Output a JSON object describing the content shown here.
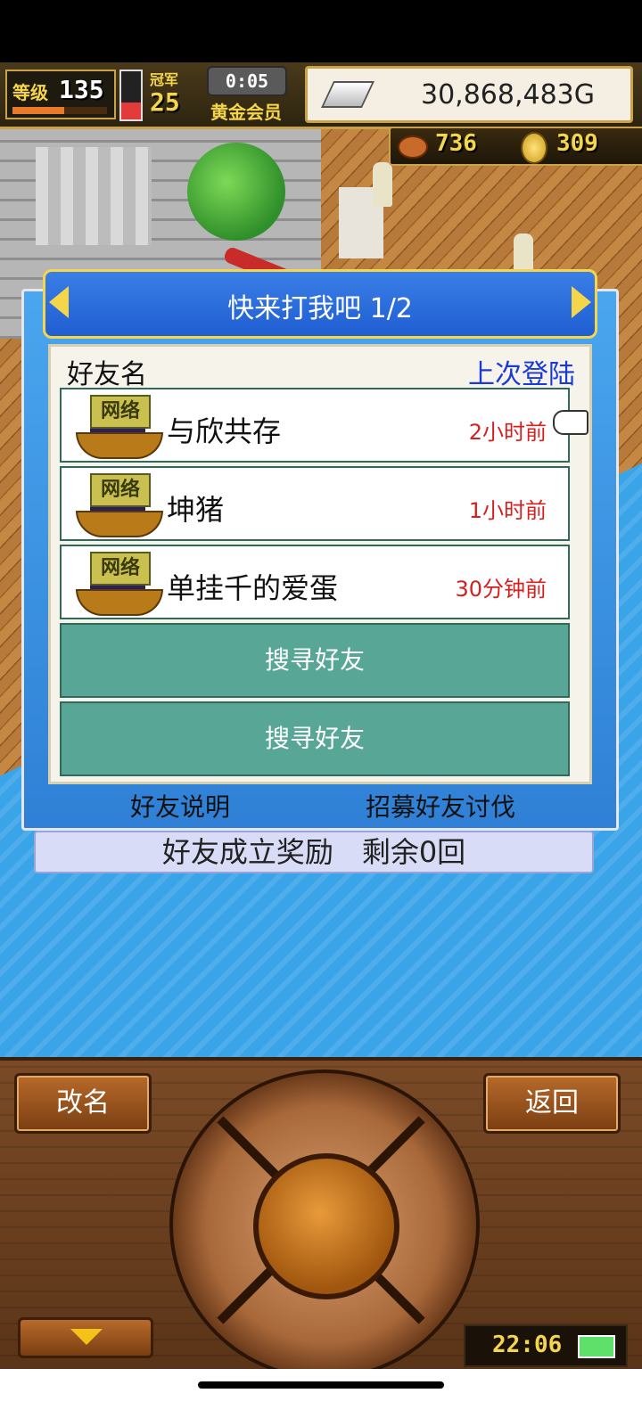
{
  "hud": {
    "level_label": "等级",
    "level": "135",
    "level_progress": 0.55,
    "stamina_fraction": 0.35,
    "trophy_label": "冠军",
    "trophy_count": "25",
    "timer": "0:05",
    "member_label": "黄金会员",
    "gold": "30,868,483G",
    "meat": "736",
    "coins": "309"
  },
  "dialog": {
    "title": "快来打我吧 1/2",
    "column_name": "好友名",
    "column_last_login": "上次登陆",
    "friends": [
      {
        "badge": "网络",
        "name": "与欣共存",
        "last_login": "2小时前"
      },
      {
        "badge": "网络",
        "name": "坤猪",
        "last_login": "1小时前"
      },
      {
        "badge": "网络",
        "name": "单挂千的爱蛋",
        "last_login": "30分钟前"
      }
    ],
    "search_slots": [
      "搜寻好友",
      "搜寻好友"
    ],
    "link_help": "好友说明",
    "link_recruit": "招募好友讨伐",
    "reward": "好友成立奖励　剩余0回"
  },
  "controls": {
    "rename": "改名",
    "back": "返回",
    "clock": "22:06"
  },
  "colors": {
    "accent_gold": "#f5d54a",
    "dialog_blue": "#2f80d6",
    "search_green": "#58a696",
    "time_red": "#d61f1f"
  }
}
